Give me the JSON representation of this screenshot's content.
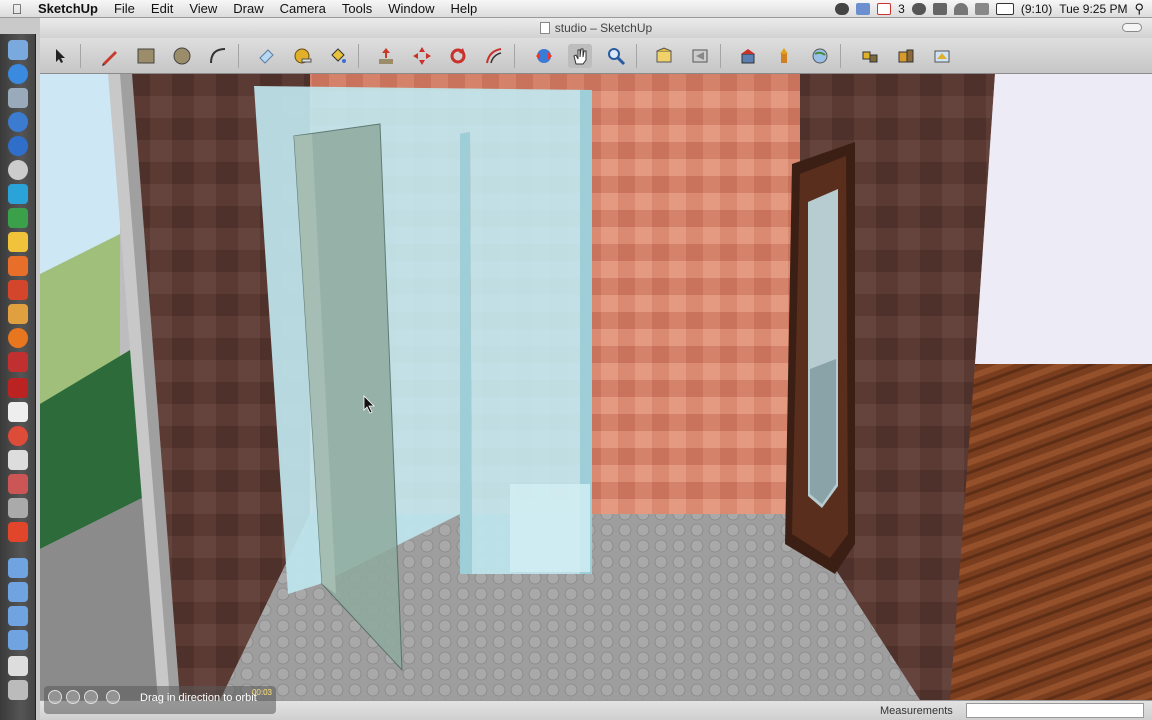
{
  "menubar": {
    "app_name": "SketchUp",
    "items": [
      "File",
      "Edit",
      "View",
      "Draw",
      "Camera",
      "Tools",
      "Window",
      "Help"
    ],
    "mail_count": "3",
    "battery": "(9:10)",
    "clock": "Tue 9:25 PM"
  },
  "window": {
    "title": "studio – SketchUp"
  },
  "statusbar": {
    "measurements_label": "Measurements",
    "measurements_value": ""
  },
  "overlay": {
    "hint": "Drag in direction to orbit",
    "time": "00:03"
  },
  "colors": {
    "accent_blue": "#3a7bd5",
    "wall_dark": "#5a3a34",
    "tile_salmon": "#d9876d",
    "glass": "#bfe6ee",
    "floor": "#9d9d9d",
    "wood_floor": "#8a4a26"
  }
}
